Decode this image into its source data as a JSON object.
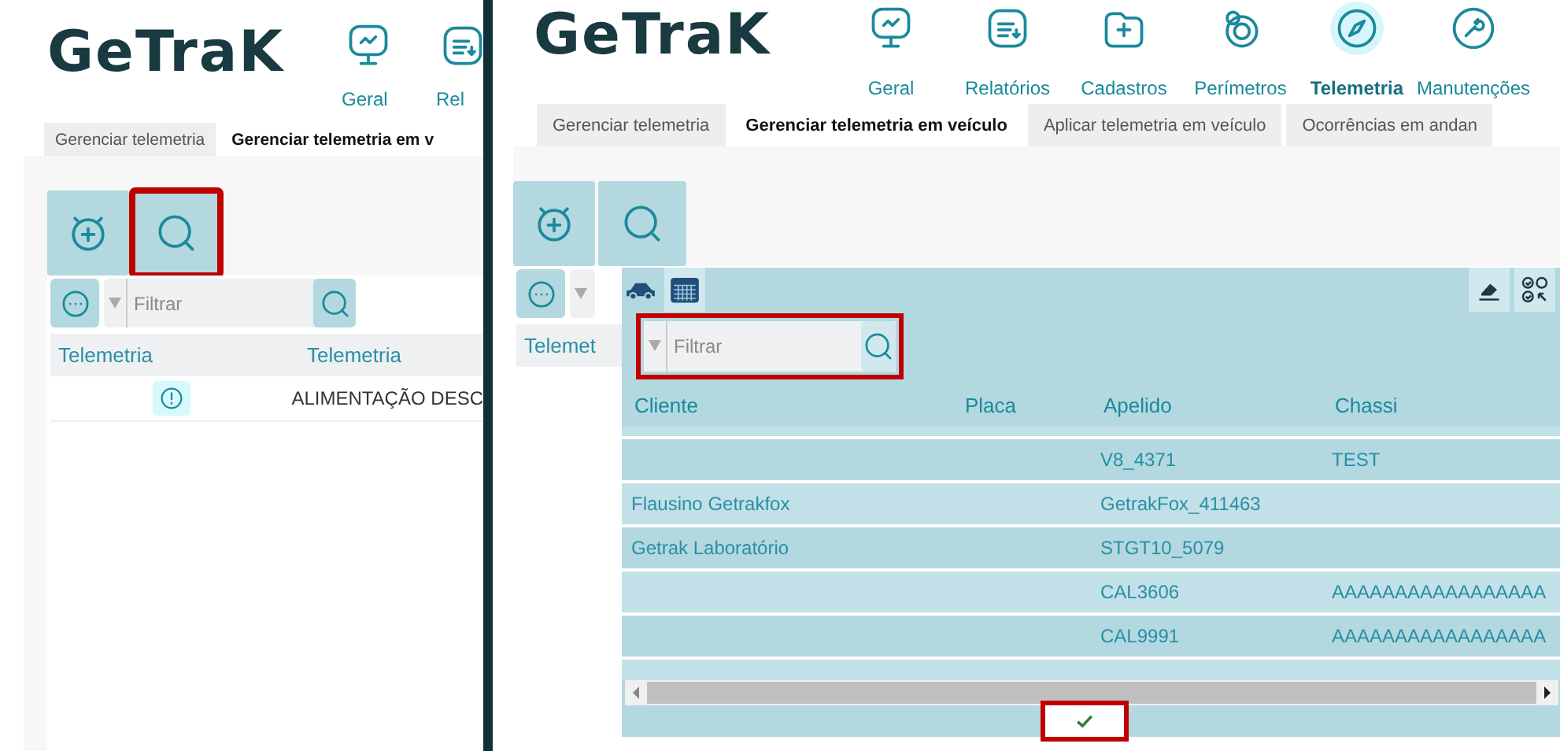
{
  "panels": [
    {
      "logo": "GeTraK",
      "nav": [
        {
          "label": "Geral",
          "selected": false
        },
        {
          "label": "Rel",
          "selected": false
        }
      ],
      "tabs": [
        {
          "label": "Gerenciar telemetria",
          "selected": false
        },
        {
          "label": "Gerenciar telemetria em v",
          "selected": true
        }
      ],
      "toolbar": [
        {
          "highlighted": false
        },
        {
          "highlighted": true
        }
      ],
      "filter": {
        "placeholder": "Filtrar"
      },
      "columns": [
        "Telemetria",
        "Telemetria"
      ],
      "rows": [
        {
          "alert": true,
          "telemetria": "ALIMENTAÇÃO DESC"
        }
      ]
    },
    {
      "logo": "GeTraK",
      "nav": [
        {
          "label": "Geral",
          "selected": false
        },
        {
          "label": "Relatórios",
          "selected": false
        },
        {
          "label": "Cadastros",
          "selected": false
        },
        {
          "label": "Perímetros",
          "selected": false
        },
        {
          "label": "Telemetria",
          "selected": true
        },
        {
          "label": "Manutenções",
          "selected": false
        }
      ],
      "tabs": [
        {
          "label": "Gerenciar telemetria",
          "selected": false
        },
        {
          "label": "Gerenciar telemetria em veículo",
          "selected": true
        },
        {
          "label": "Aplicar telemetria em veículo",
          "selected": false
        },
        {
          "label": "Ocorrências em andan",
          "selected": false
        }
      ],
      "toolbar": [
        {
          "highlighted": false
        },
        {
          "highlighted": false
        }
      ],
      "columns": [
        "Telemet"
      ],
      "popup": {
        "tabs": [
          {
            "selected": false
          },
          {
            "selected": true
          }
        ],
        "filter": {
          "placeholder": "Filtrar",
          "highlighted": true
        },
        "columns": [
          "Cliente",
          "Placa",
          "Apelido",
          "Chassi"
        ],
        "rows": [
          {
            "cells": [
              "",
              "",
              "V8_4371",
              "TEST"
            ]
          },
          {
            "cells": [
              "Flausino Getrakfox",
              "",
              "GetrakFox_411463",
              ""
            ]
          },
          {
            "cells": [
              "Getrak Laboratório",
              "",
              "STGT10_5079",
              ""
            ]
          },
          {
            "cells": [
              "",
              "",
              "CAL3606",
              "AAAAAAAAAAAAAAAAA"
            ]
          },
          {
            "cells": [
              "",
              "",
              "CAL9991",
              "AAAAAAAAAAAAAAAAA"
            ]
          }
        ],
        "confirm": {
          "highlighted": true
        }
      }
    }
  ]
}
